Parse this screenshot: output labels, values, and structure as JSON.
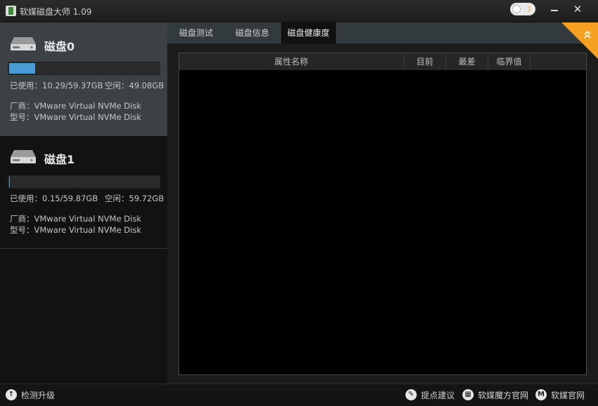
{
  "window": {
    "title": "软媒磁盘大师 1.09"
  },
  "disks": [
    {
      "name": "磁盘0",
      "used_label": "已使用：10.29/59.37GB",
      "free_label": "空闲：49.08GB",
      "vendor_label": "厂商：VMware Virtual NVMe Disk",
      "model_label": "型号：VMware Virtual NVMe Disk",
      "usage_fraction": 0.173
    },
    {
      "name": "磁盘1",
      "used_label": "已使用：0.15/59.87GB",
      "free_label": "空闲：59.72GB",
      "vendor_label": "厂商：VMware Virtual NVMe Disk",
      "model_label": "型号：VMware Virtual NVMe Disk",
      "usage_fraction": 0.0025
    }
  ],
  "tabs": [
    {
      "label": "磁盘测试"
    },
    {
      "label": "磁盘信息"
    },
    {
      "label": "磁盘健康度"
    }
  ],
  "active_tab": "磁盘健康度",
  "table": {
    "columns": [
      "属性名称",
      "目前",
      "最差",
      "临界值"
    ],
    "rows": []
  },
  "footer": {
    "update_label": "检测升级",
    "feedback_label": "提点建议",
    "rubik_label": "软媒魔方官网",
    "site_label": "软媒官网"
  },
  "colors": {
    "accent": "#4b9ad8",
    "badge": "#f5a020"
  }
}
